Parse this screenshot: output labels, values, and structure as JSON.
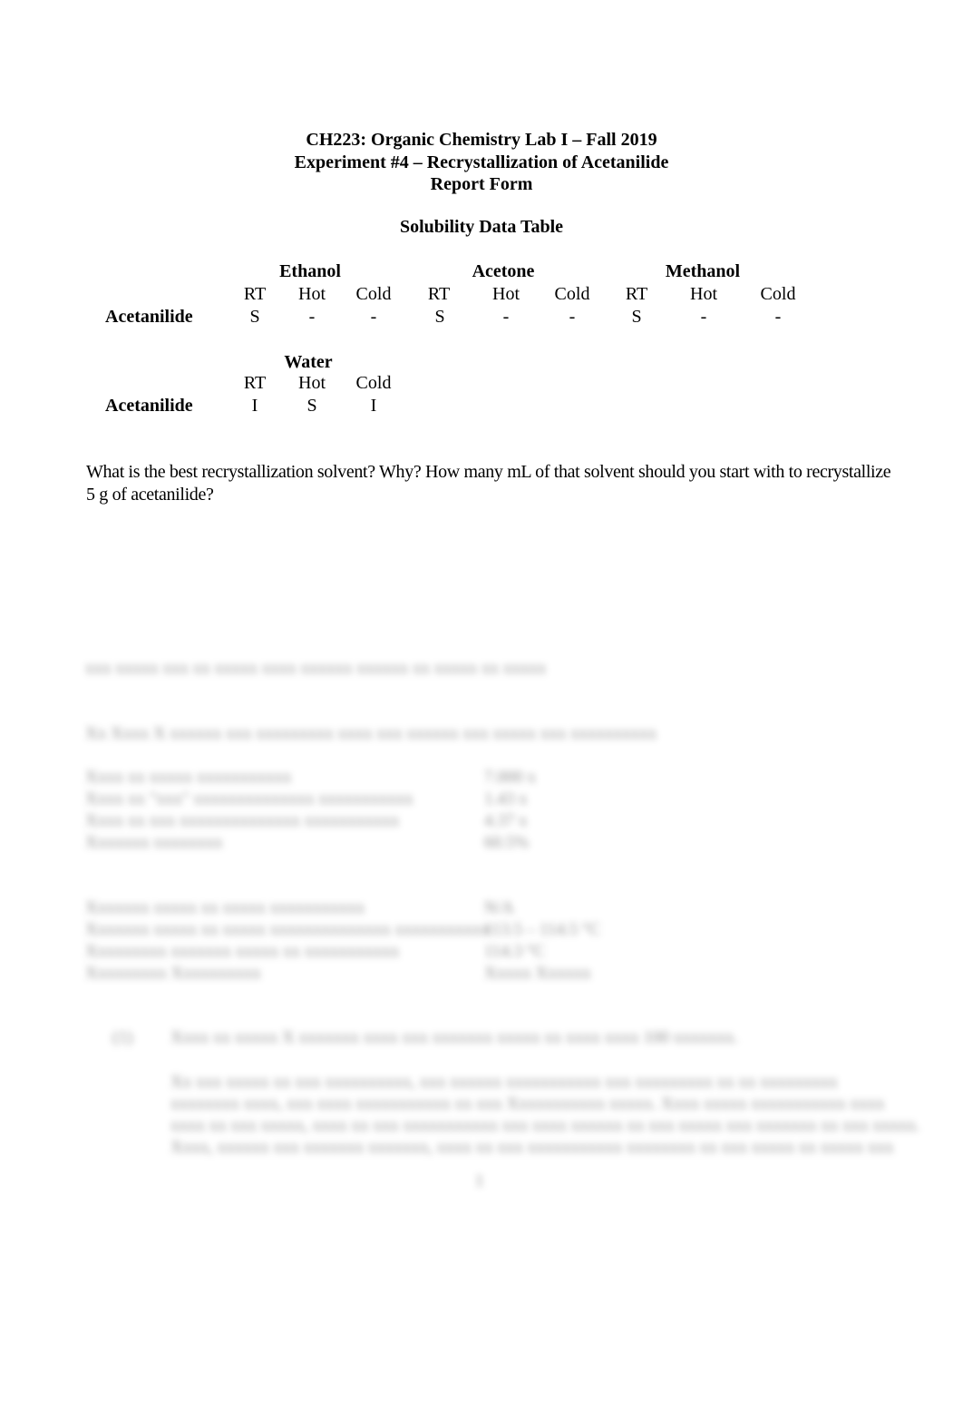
{
  "header": {
    "line1": "CH223: Organic Chemistry Lab I – Fall 2019",
    "line2": "Experiment #4 – Recrystallization of Acetanilide",
    "line3": "Report Form"
  },
  "solubility_table": {
    "title": "Solubility Data Table",
    "row_label": "Acetanilide",
    "solvents": [
      {
        "name": "Ethanol",
        "columns": [
          "RT",
          "Hot",
          "Cold"
        ],
        "values": [
          "S",
          "-",
          "-"
        ]
      },
      {
        "name": "Acetone",
        "columns": [
          "RT",
          "Hot",
          "Cold"
        ],
        "values": [
          "S",
          "-",
          "-"
        ]
      },
      {
        "name": "Methanol",
        "columns": [
          "RT",
          "Hot",
          "Cold"
        ],
        "values": [
          "S",
          "-",
          "-"
        ]
      },
      {
        "name": "Water",
        "columns": [
          "RT",
          "Hot",
          "Cold"
        ],
        "values": [
          "I",
          "S",
          "I"
        ]
      }
    ]
  },
  "question": "What is the best recrystallization solvent?  Why?  How many mL of that solvent should you start with to recrystallize 5 g of acetanilide?",
  "blurred_preview": {
    "lines": [
      "xxx xxxxx xxx xx xxxxx xxxx xxxxxx xxxxxx xx xxxxx xx xxxxx",
      "Xx Xxxx X xxxxxx xxx xxxxxxxxx xxxx xxx xxxxxx xxx xxxxx xxx xxxxxxxxxx",
      "Xxxx xx xxxxx xxxxxxxxxxx",
      "Xxxx xx \"xxx\" xxxxxxxxxxxxxx xxxxxxxxxxx",
      "Xxxx xx xxx xxxxxxxxxxxxxx xxxxxxxxxxx",
      "Xxxxxxx xxxxxxxx",
      "Xxxxxxx xxxxx xx xxxxx xxxxxxxxxxx",
      "Xxxxxxx xxxxx xx xxxxx xxxxxxxxxxxxxx xxxxxxxxxxx",
      "Xxxxxxxxx xxxxxxx xxxxx xx xxxxxxxxxxx",
      "Xxxxxxxxx Xxxxxxxxxx",
      "(1)",
      "Xxxx xx xxxxx X xxxxxxx xxxx xxx xxxxxxx xxxxx xx xxxx xxxx 100 xxxxxxx.",
      "Xx xxx xxxxx xx xxx xxxxxxxxxx, xxx xxxxxx xxxxxxxxxxx xxx xxxxxxxxx xx xx xxxxxxxxx",
      "xxxxxxxx xxxx, xxx xxxx xxxxxxxxxxx xx xxx Xxxxxxxxxxx xxxxx. Xxxx xxxxx xxxxxxxxxxx xxxx",
      "xxxx xx xxx xxxxx, xxxx xx xxx xxxxxxxxxxx xxx xxxx xxxxxx xx xxx xxxxx xxx xxxxxxx xx xxx xxxxx.",
      "Xxxx, xxxxxx xxx xxxxxxx xxxxxxx, xxxx xx xxx xxxxxxxxxxx xxxxxxxx xx xxx xxxxx xx xxxxx xxx",
      "1"
    ],
    "values": [
      "7.000 x",
      "1.43 x",
      "4.37 x",
      "60.5%",
      "N/A",
      "113.5 – 114.5 °C",
      "114.3 °C",
      "Xxxxx Xxxxxx"
    ]
  }
}
